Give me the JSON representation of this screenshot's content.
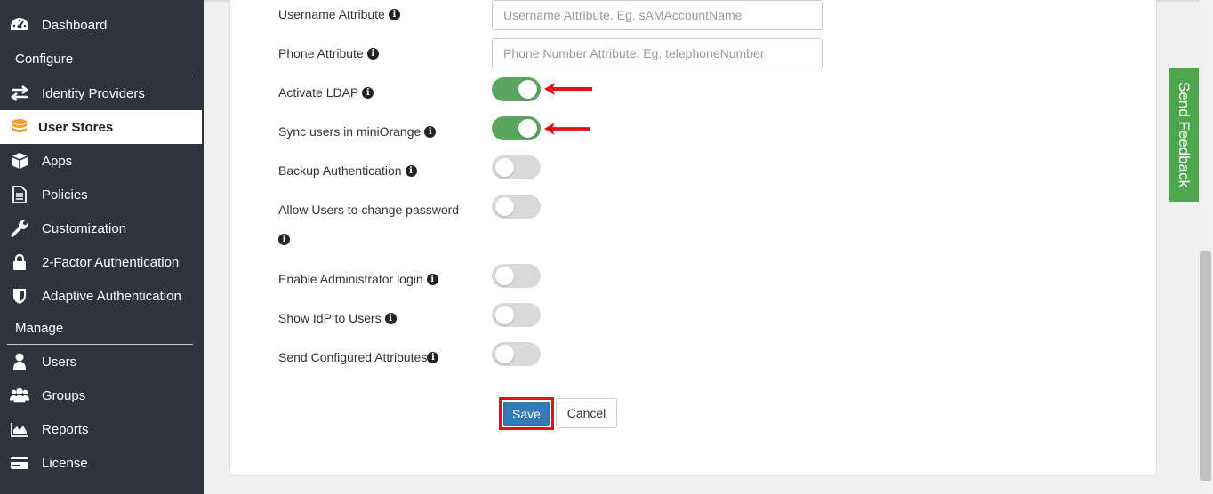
{
  "sidebar": {
    "items": [
      {
        "label": "Dashboard",
        "icon": "dashboard-icon"
      },
      {
        "label": "Identity Providers",
        "icon": "exchange-icon"
      },
      {
        "label": "User Stores",
        "icon": "database-icon",
        "active": true
      },
      {
        "label": "Apps",
        "icon": "cube-icon"
      },
      {
        "label": "Policies",
        "icon": "document-icon"
      },
      {
        "label": "Customization",
        "icon": "wrench-icon"
      },
      {
        "label": "2-Factor Authentication",
        "icon": "lock-icon"
      },
      {
        "label": "Adaptive Authentication",
        "icon": "shield-icon"
      },
      {
        "label": "Users",
        "icon": "user-icon"
      },
      {
        "label": "Groups",
        "icon": "users-icon"
      },
      {
        "label": "Reports",
        "icon": "area-chart-icon"
      },
      {
        "label": "License",
        "icon": "credit-card-icon"
      }
    ],
    "section_configure": "Configure",
    "section_manage": "Manage"
  },
  "form": {
    "username_attribute": {
      "label": "Username Attribute",
      "placeholder": "Username Attribute. Eg. sAMAccountName",
      "value": ""
    },
    "phone_attribute": {
      "label": "Phone Attribute",
      "placeholder": "Phone Number Attribute. Eg. telephoneNumber",
      "value": ""
    },
    "toggles": [
      {
        "label": "Activate LDAP",
        "on": true
      },
      {
        "label": "Sync users in miniOrange",
        "on": true
      },
      {
        "label": "Backup Authentication",
        "on": false
      },
      {
        "label": "Allow Users to change password",
        "on": false
      },
      {
        "label": "Enable Administrator login",
        "on": false
      },
      {
        "label": "Show IdP to Users",
        "on": false
      },
      {
        "label": "Send Configured Attributes",
        "on": false
      }
    ],
    "save_label": "Save",
    "cancel_label": "Cancel"
  },
  "feedback_label": "Send Feedback",
  "colors": {
    "sidebar_bg": "#2f353c",
    "toggle_on": "#5aa55f",
    "toggle_off": "#d9d9d9",
    "primary": "#337ab7",
    "highlight": "#e31218",
    "feedback": "#4ea64e"
  }
}
